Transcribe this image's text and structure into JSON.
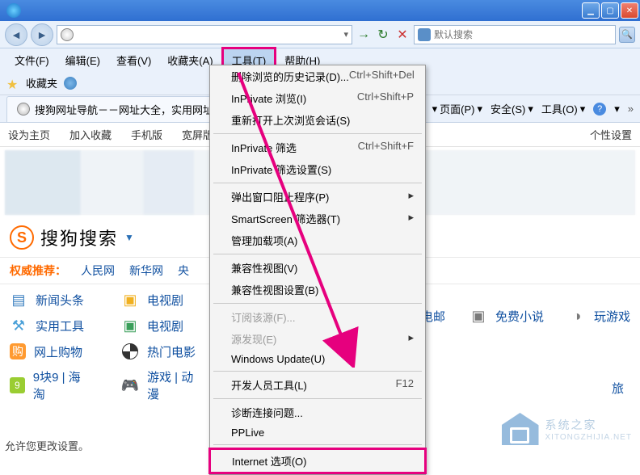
{
  "menubar": {
    "file": "文件(F)",
    "edit": "编辑(E)",
    "view": "查看(V)",
    "favorites": "收藏夹(A)",
    "tools": "工具(T)",
    "help": "帮助(H)"
  },
  "favbar": {
    "label": "收藏夹"
  },
  "tab": {
    "title": "搜狗网址导航－－网址大全，实用网址，尽"
  },
  "toolbar_right": {
    "page": "页面(P)",
    "safety": "安全(S)",
    "tools": "工具(O)"
  },
  "search": {
    "placeholder": "默认搜索"
  },
  "dropdown": {
    "items": [
      {
        "label": "删除浏览的历史记录(D)...",
        "shortcut": "Ctrl+Shift+Del"
      },
      {
        "label": "InPrivate 浏览(I)",
        "shortcut": "Ctrl+Shift+P"
      },
      {
        "label": "重新打开上次浏览会话(S)",
        "shortcut": ""
      }
    ],
    "group2": [
      {
        "label": "InPrivate 筛选",
        "shortcut": "Ctrl+Shift+F"
      },
      {
        "label": "InPrivate 筛选设置(S)",
        "shortcut": ""
      }
    ],
    "group3": [
      {
        "label": "弹出窗口阻止程序(P)",
        "sub": true
      },
      {
        "label": "SmartScreen 筛选器(T)",
        "sub": true
      },
      {
        "label": "管理加载项(A)"
      }
    ],
    "group4": [
      {
        "label": "兼容性视图(V)"
      },
      {
        "label": "兼容性视图设置(B)"
      }
    ],
    "group5": [
      {
        "label": "订阅该源(F)..."
      },
      {
        "label": "源发现(E)",
        "sub": true
      },
      {
        "label": "Windows Update(U)"
      }
    ],
    "group6": [
      {
        "label": "开发人员工具(L)",
        "shortcut": "F12"
      }
    ],
    "group7": [
      {
        "label": "诊断连接问题..."
      },
      {
        "label": "PPLive"
      }
    ],
    "internet_options": "Internet 选项(O)"
  },
  "pagenav": {
    "home": "设为主页",
    "addfav": "加入收藏",
    "mobile": "手机版",
    "wide": "宽屏版",
    "personal": "个性设置"
  },
  "sogou": {
    "text": "搜狗搜索"
  },
  "recommend": {
    "label": "权威推荐：",
    "links": [
      "人民网",
      "新华网",
      "央"
    ]
  },
  "cats_left": [
    {
      "icon": "news",
      "text": "新闻头条"
    },
    {
      "icon": "tv",
      "text": "电视剧"
    },
    {
      "icon": "tool",
      "text": "实用工具"
    },
    {
      "icon": "tv2",
      "text": "电视剧"
    },
    {
      "icon": "shop",
      "text": "网上购物"
    },
    {
      "icon": "movie",
      "text": "热门电影"
    },
    {
      "icon": "nine",
      "text": "9块9 | 海淘"
    },
    {
      "icon": "game",
      "text": "游戏 | 动漫"
    }
  ],
  "cats_right": [
    {
      "text": "电邮"
    },
    {
      "text": "免费小说"
    },
    {
      "text": "玩游戏"
    }
  ],
  "footer": "允许您更改设置。",
  "watermark": {
    "name": "系统之家",
    "sub": "XITONGZHIJIA.NET"
  },
  "right_char": "旅"
}
